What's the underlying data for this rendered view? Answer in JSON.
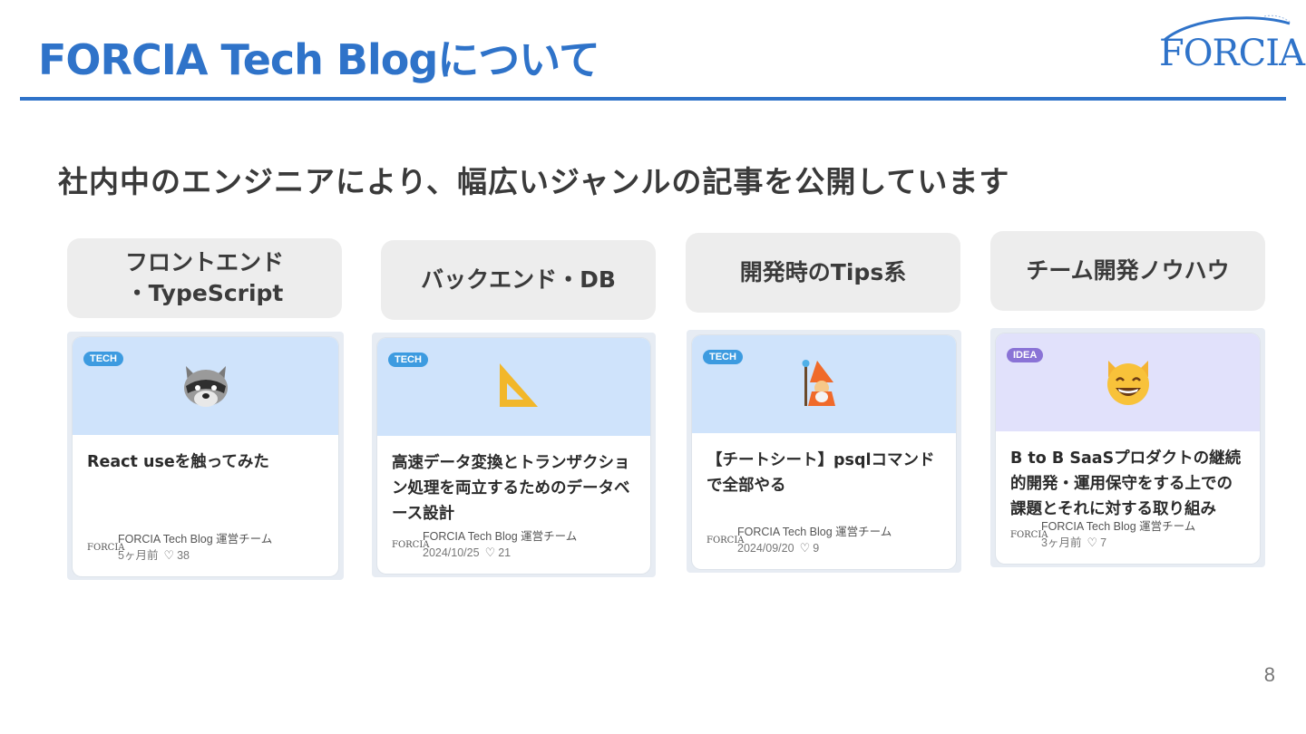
{
  "header": {
    "title": "FORCIA Tech Blogについて",
    "logo_text": "FORCIA"
  },
  "subtitle": "社内中のエンジニアにより、幅広いジャンルの記事を公開しています",
  "categories": [
    {
      "label": "フロントエンド\n・TypeScript"
    },
    {
      "label": "バックエンド・DB"
    },
    {
      "label": "開発時のTips系"
    },
    {
      "label": "チーム開発ノウハウ"
    }
  ],
  "cards": [
    {
      "badge": "TECH",
      "emoji": "raccoon-icon",
      "title": "React useを触ってみた",
      "author": "FORCIA Tech Blog 運営チーム",
      "date": "5ヶ月前",
      "likes": "38",
      "author_logo": "FORCIA"
    },
    {
      "badge": "TECH",
      "emoji": "triangular-ruler-icon",
      "title": "高速データ変換とトランザクション処理を両立するためのデータベース設計",
      "author": "FORCIA Tech Blog 運営チーム",
      "date": "2024/10/25",
      "likes": "21",
      "author_logo": "FORCIA"
    },
    {
      "badge": "TECH",
      "emoji": "mage-icon",
      "title": "【チートシート】psqlコマンドで全部やる",
      "author": "FORCIA Tech Blog 運営チーム",
      "date": "2024/09/20",
      "likes": "9",
      "author_logo": "FORCIA"
    },
    {
      "badge": "IDEA",
      "emoji": "grinning-cat-icon",
      "title": "B to B SaaSプロダクトの継続的開発・運用保守をする上での課題とそれに対する取り組み",
      "author": "FORCIA Tech Blog 運営チーム",
      "date": "3ヶ月前",
      "likes": "7",
      "author_logo": "FORCIA"
    }
  ],
  "page_number": "8",
  "colors": {
    "accent": "#2f73c9",
    "tech_badge": "#3d9be0",
    "idea_badge": "#8a73d6"
  }
}
